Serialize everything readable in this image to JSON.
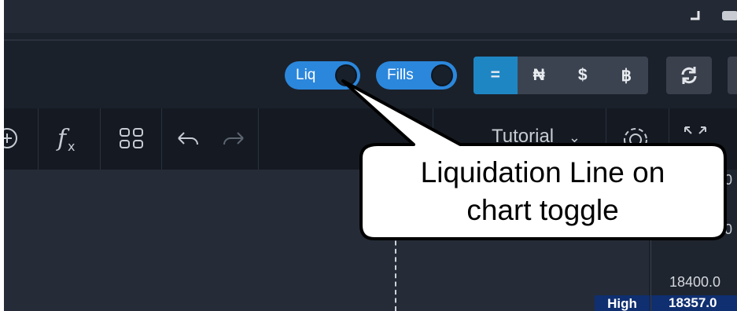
{
  "toggles": {
    "liq_label": "Liq",
    "fills_label": "Fills"
  },
  "currency_selector": {
    "options": [
      "=",
      "₦",
      "$",
      "฿"
    ],
    "selected": "="
  },
  "chart_toolbar": {
    "tutorial_label": "Tutorial"
  },
  "price_axis": {
    "partial_digits": [
      "0",
      "0"
    ],
    "price_label": "18400.0",
    "high_tag": "High",
    "high_value": "18357.0"
  },
  "callout": {
    "line1": "Liquidation Line on",
    "line2": "chart toggle",
    "fill": "#ffffff",
    "stroke": "#000000"
  },
  "colors": {
    "toggle_blue": "#2b87dc",
    "segment_active": "#1f86c4",
    "high_tag_bg": "#0f2f70"
  },
  "icons": [
    "add-circle-icon",
    "function-icon",
    "layout-grid-icon",
    "undo-icon",
    "redo-icon",
    "gear-icon",
    "fullscreen-icon",
    "refresh-icon",
    "chevron-down-icon"
  ]
}
